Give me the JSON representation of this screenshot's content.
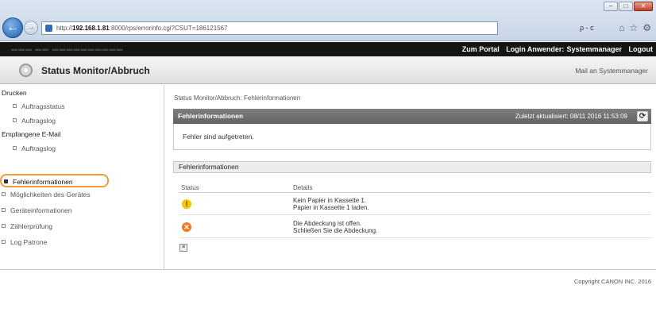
{
  "browser": {
    "address_prefix": "http://",
    "address_host": "192.168.1.81",
    "address_rest": ":8000/rps/errorinfo.cgi?CSUT=186121567",
    "search_label": "ρ - c",
    "toolbar_icons": [
      "home-icon",
      "star-icon",
      "gear-icon"
    ]
  },
  "header": {
    "links": [
      "Zum Portal",
      "Login Anwender:",
      "Systemmanager",
      "Logout"
    ],
    "page_title": "Status Monitor/Abbruch",
    "mail_link": "Mail an Systemmanager"
  },
  "sidebar": {
    "groups": [
      {
        "label": "Drucken",
        "items": [
          "Auftragsstatus",
          "Auftragslog"
        ]
      },
      {
        "label": "Empfangene E-Mail",
        "items": [
          "Auftragslog"
        ]
      }
    ],
    "top_items": [
      "Fehlerinformationen",
      "Möglichkeiten des Gerätes",
      "Geräteinformationen",
      "Zählerprüfung",
      "Log Patrone"
    ],
    "active_index": 0
  },
  "main": {
    "breadcrumb": "Status Monitor/Abbruch: Fehlerinformationen",
    "panel_title": "Fehlerinformationen",
    "last_updated": "Zuletzt aktualisiert: 08/11 2016 11:53:09",
    "panel_message": "Fehler sind aufgetreten.",
    "section_title": "Fehlerinformationen",
    "columns": [
      "Status",
      "Details"
    ],
    "rows": [
      {
        "icon": "warning-icon",
        "line1": "Kein Papier in Kassette 1.",
        "line2": "Papier in Kassette 1 laden."
      },
      {
        "icon": "error-icon",
        "line1": "Die Abdeckung ist offen.",
        "line2": "Schließen Sie die Abdeckung."
      }
    ]
  },
  "footer": {
    "copyright": "Copyright CANON INC. 2016"
  },
  "colors": {
    "highlight": "#f09b3b",
    "header_bar": "#151515",
    "panel_head": "#6e6e6e",
    "warning": "#f3c400",
    "error": "#ee7a22"
  }
}
